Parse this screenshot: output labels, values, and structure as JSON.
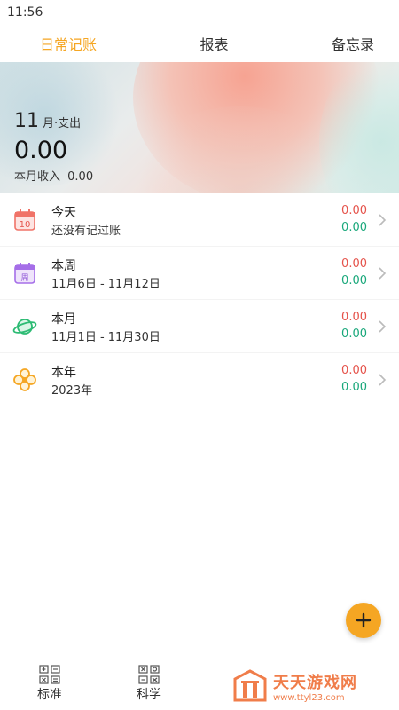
{
  "status_bar": {
    "time": "11:56"
  },
  "tabs": [
    {
      "label": "日常记账",
      "active": true
    },
    {
      "label": "报表",
      "active": false
    },
    {
      "label": "备忘录",
      "active": false
    }
  ],
  "summary": {
    "month_number": "11",
    "month_label": "月·支出",
    "expense_total": "0.00",
    "income_label": "本月收入",
    "income_value": "0.00"
  },
  "periods": [
    {
      "icon": "calendar-today-icon",
      "icon_text": "10",
      "title": "今天",
      "subtitle": "还没有记过账",
      "expense": "0.00",
      "income": "0.00"
    },
    {
      "icon": "calendar-week-icon",
      "icon_text": "周",
      "title": "本周",
      "subtitle": "11月6日 - 11月12日",
      "expense": "0.00",
      "income": "0.00"
    },
    {
      "icon": "planet-icon",
      "title": "本月",
      "subtitle": "11月1日 - 11月30日",
      "expense": "0.00",
      "income": "0.00"
    },
    {
      "icon": "clover-icon",
      "title": "本年",
      "subtitle": "2023年",
      "expense": "0.00",
      "income": "0.00"
    }
  ],
  "bottom": {
    "standard_label": "标准",
    "scientific_label": "科学"
  },
  "watermark": {
    "title": "天天游戏网",
    "url": "www.ttyl23.com"
  },
  "colors": {
    "accent": "#f5a623",
    "expense": "#e5534b",
    "income": "#1aa87b"
  }
}
